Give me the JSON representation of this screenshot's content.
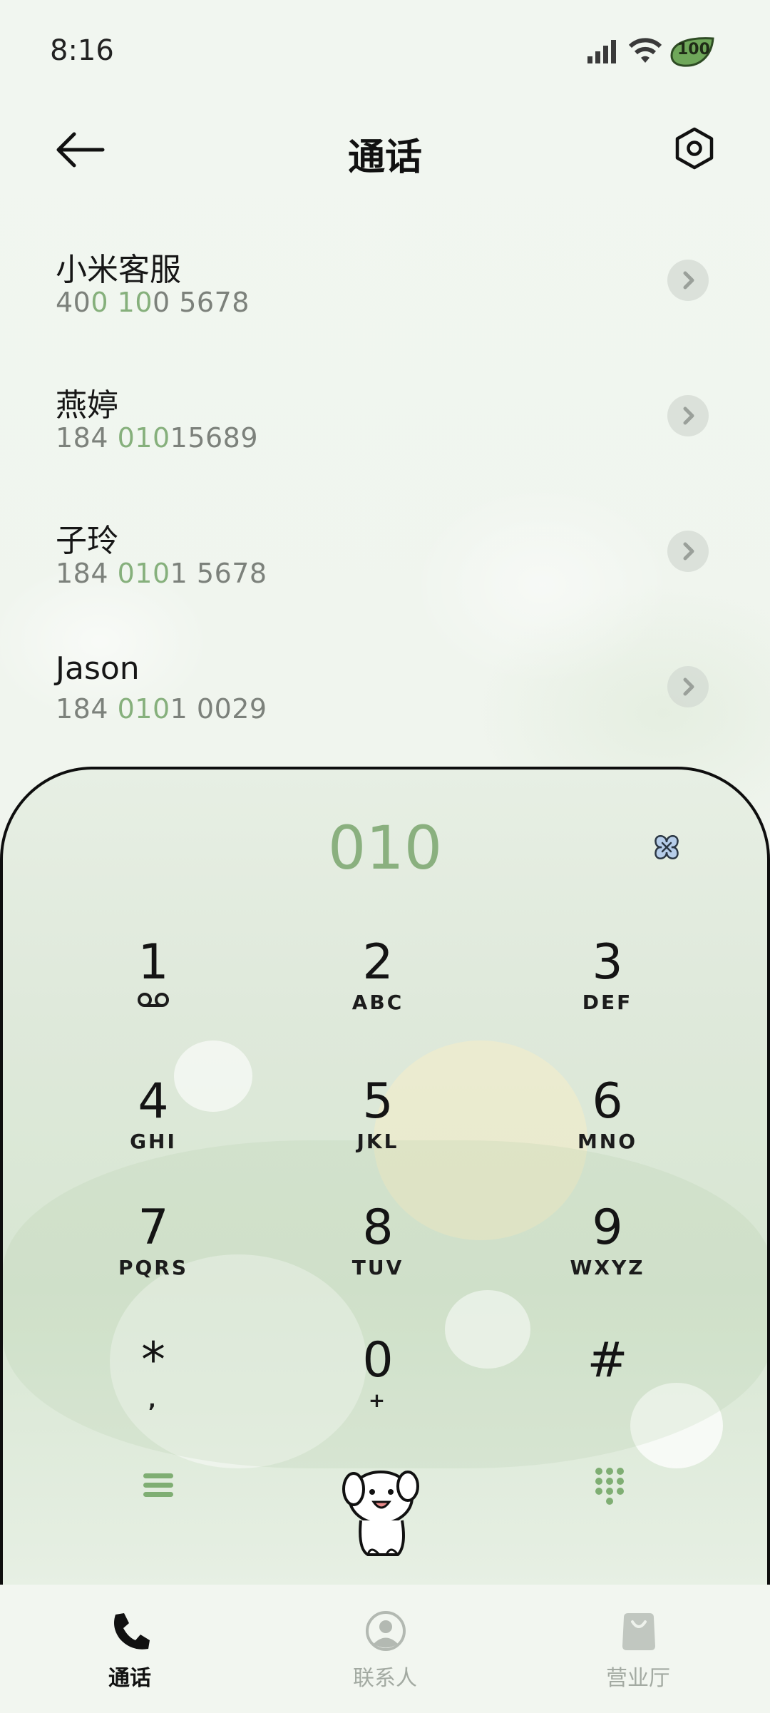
{
  "status_bar": {
    "time": "8:16",
    "battery": "100",
    "icons": [
      "signal-icon",
      "wifi-icon",
      "battery-leaf-icon"
    ]
  },
  "header": {
    "title": "通话",
    "back_icon": "back-arrow-icon",
    "settings_icon": "settings-hexagon-icon"
  },
  "contacts": [
    {
      "name": "小米客服",
      "num_parts": [
        "40",
        "0",
        " ",
        "10",
        "0 5678"
      ]
    },
    {
      "name": "燕婷",
      "num_parts": [
        "184 ",
        "010",
        "15689",
        "",
        ""
      ]
    },
    {
      "name": "子玲",
      "num_parts": [
        "184 ",
        "010",
        "1 5678",
        "",
        ""
      ]
    },
    {
      "name": "Jason",
      "num_parts": [
        "184 ",
        "010",
        "1 0029",
        "",
        ""
      ]
    }
  ],
  "dialer": {
    "input": "010",
    "keys": [
      {
        "digit": "1",
        "letters": ""
      },
      {
        "digit": "2",
        "letters": "ABC"
      },
      {
        "digit": "3",
        "letters": "DEF"
      },
      {
        "digit": "4",
        "letters": "GHI"
      },
      {
        "digit": "5",
        "letters": "JKL"
      },
      {
        "digit": "6",
        "letters": "MNO"
      },
      {
        "digit": "7",
        "letters": "PQRS"
      },
      {
        "digit": "8",
        "letters": "TUV"
      },
      {
        "digit": "9",
        "letters": "WXYZ"
      },
      {
        "digit": "*",
        "letters": ","
      },
      {
        "digit": "0",
        "letters": "+"
      },
      {
        "digit": "#",
        "letters": ""
      }
    ]
  },
  "bottom_nav": [
    {
      "label": "通话",
      "icon": "phone-icon",
      "active": true
    },
    {
      "label": "联系人",
      "icon": "contact-icon",
      "active": false
    },
    {
      "label": "营业厅",
      "icon": "shopping-bag-icon",
      "active": false
    }
  ],
  "colors": {
    "accent": "#86b07c",
    "text": "#111111",
    "muted": "#7c817b",
    "inactive": "#a3aaa2"
  }
}
